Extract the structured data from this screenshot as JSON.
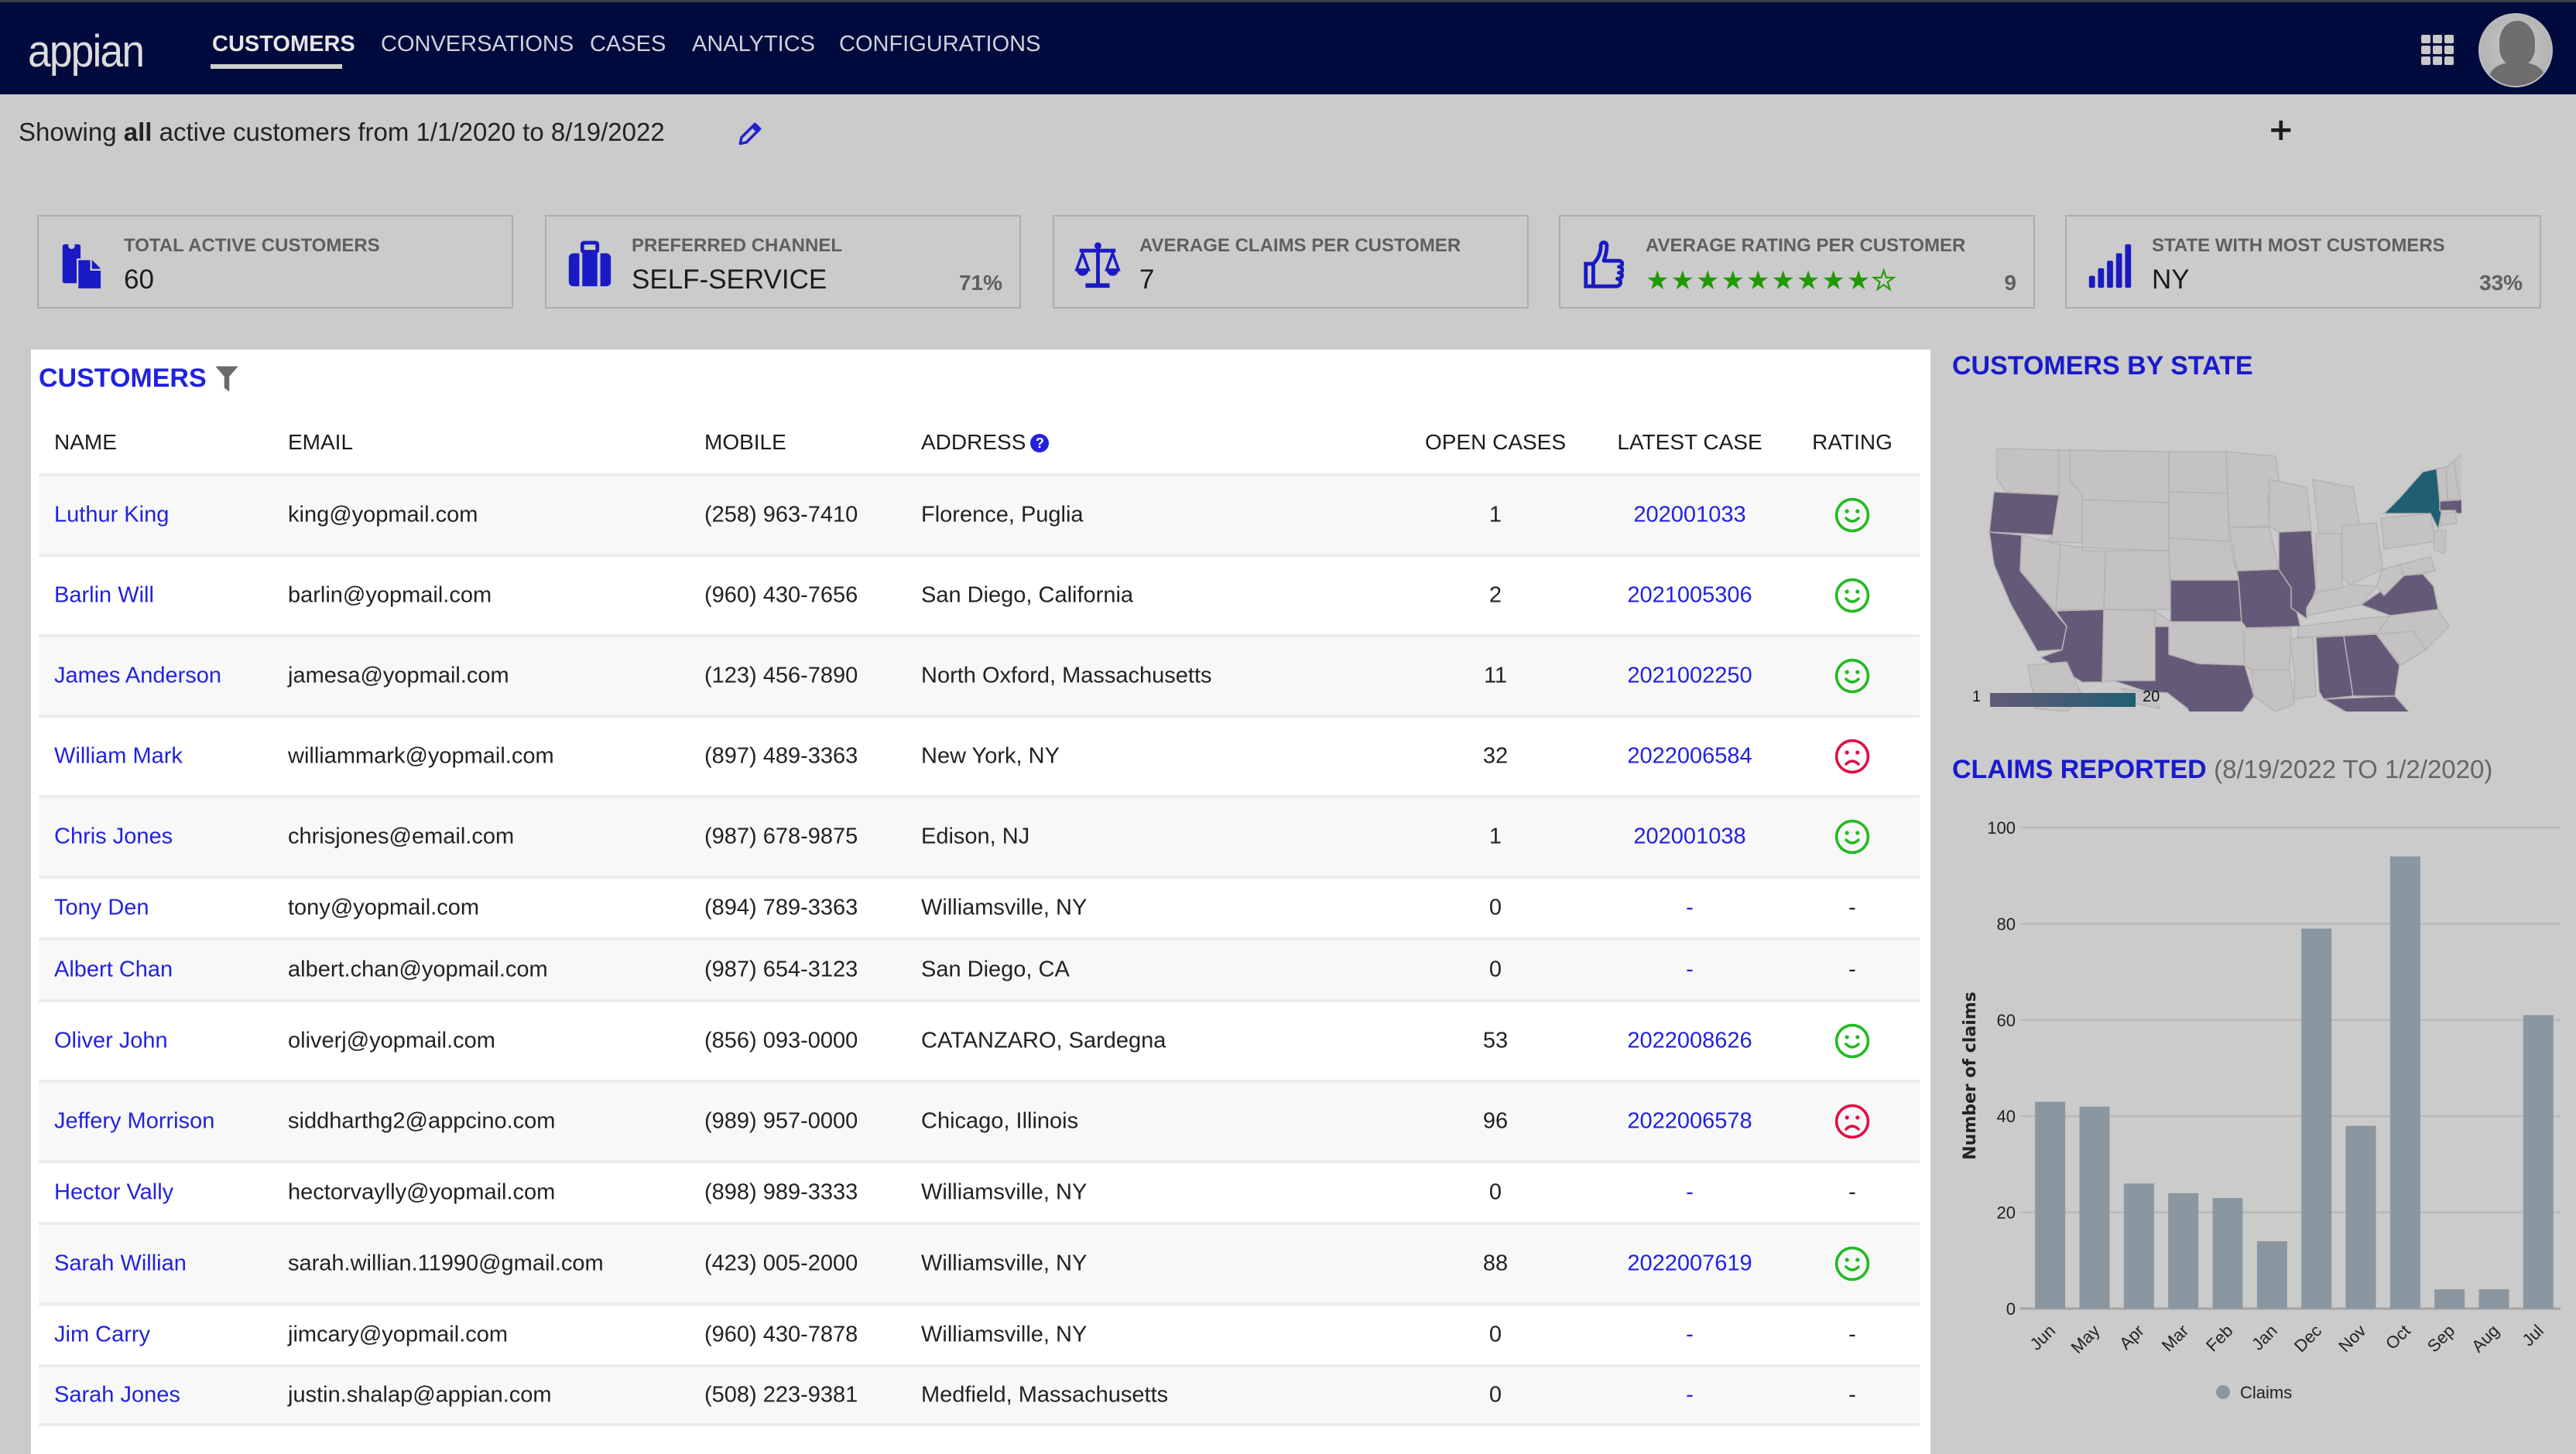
{
  "app": {
    "logo_text": "appian",
    "nav": [
      {
        "label": "CUSTOMERS",
        "active": true
      },
      {
        "label": "CONVERSATIONS",
        "active": false
      },
      {
        "label": "CASES",
        "active": false
      },
      {
        "label": "ANALYTICS",
        "active": false
      },
      {
        "label": "CONFIGURATIONS",
        "active": false
      }
    ],
    "icons": {
      "apps": "grid-icon",
      "user": "avatar-icon"
    }
  },
  "subtitle": {
    "prefix": "Showing ",
    "bold": "all",
    "suffix": " active customers from 1/1/2020 to 8/19/2022"
  },
  "kpis": [
    {
      "label": "TOTAL ACTIVE CUSTOMERS",
      "value": "60",
      "pct": "",
      "icon": "clipboard-icon"
    },
    {
      "label": "PREFERRED CHANNEL",
      "value": "SELF-SERVICE",
      "pct": "71%",
      "icon": "briefcase-icon"
    },
    {
      "label": "AVERAGE CLAIMS PER CUSTOMER",
      "value": "7",
      "pct": "",
      "icon": "scale-icon"
    },
    {
      "label": "AVERAGE RATING PER CUSTOMER",
      "value": "",
      "pct": "9",
      "icon": "thumbs-up-icon",
      "stars_filled": 9,
      "stars_total": 10
    },
    {
      "label": "STATE WITH MOST CUSTOMERS",
      "value": "NY",
      "pct": "33%",
      "icon": "signal-bars-icon"
    }
  ],
  "customers": {
    "title": "CUSTOMERS",
    "columns": [
      "NAME",
      "EMAIL",
      "MOBILE",
      "ADDRESS",
      "OPEN CASES",
      "LATEST CASE",
      "RATING"
    ],
    "rows": [
      {
        "name": "Luthur King",
        "email": "king@yopmail.com",
        "mobile": "(258) 963-7410",
        "address": "Florence, Puglia",
        "open": "1",
        "latest": "202001033",
        "rating": "happy"
      },
      {
        "name": "Barlin Will",
        "email": "barlin@yopmail.com",
        "mobile": "(960) 430-7656",
        "address": "San Diego, California",
        "open": "2",
        "latest": "2021005306",
        "rating": "happy"
      },
      {
        "name": "James Anderson",
        "email": "jamesa@yopmail.com",
        "mobile": "(123) 456-7890",
        "address": "North Oxford, Massachusetts",
        "open": "11",
        "latest": "2021002250",
        "rating": "happy"
      },
      {
        "name": "William Mark",
        "email": "williammark@yopmail.com",
        "mobile": "(897) 489-3363",
        "address": "New York, NY",
        "open": "32",
        "latest": "2022006584",
        "rating": "sad"
      },
      {
        "name": "Chris Jones",
        "email": "chrisjones@email.com",
        "mobile": "(987) 678-9875",
        "address": "Edison, NJ",
        "open": "1",
        "latest": "202001038",
        "rating": "happy"
      },
      {
        "name": "Tony Den",
        "email": "tony@yopmail.com",
        "mobile": "(894) 789-3363",
        "address": "Williamsville, NY",
        "open": "0",
        "latest": "-",
        "rating": "-"
      },
      {
        "name": "Albert Chan",
        "email": "albert.chan@yopmail.com",
        "mobile": "(987) 654-3123",
        "address": "San Diego, CA",
        "open": "0",
        "latest": "-",
        "rating": "-"
      },
      {
        "name": "Oliver John",
        "email": "oliverj@yopmail.com",
        "mobile": "(856) 093-0000",
        "address": "CATANZARO, Sardegna",
        "open": "53",
        "latest": "2022008626",
        "rating": "happy"
      },
      {
        "name": "Jeffery Morrison",
        "email": "siddharthg2@appcino.com",
        "mobile": "(989) 957-0000",
        "address": "Chicago, Illinois",
        "open": "96",
        "latest": "2022006578",
        "rating": "sad"
      },
      {
        "name": "Hector Vally",
        "email": "hectorvaylly@yopmail.com",
        "mobile": "(898) 989-3333",
        "address": "Williamsville, NY",
        "open": "0",
        "latest": "-",
        "rating": "-"
      },
      {
        "name": "Sarah Willian",
        "email": "sarah.willian.11990@gmail.com",
        "mobile": "(423) 005-2000",
        "address": "Williamsville, NY",
        "open": "88",
        "latest": "2022007619",
        "rating": "happy"
      },
      {
        "name": "Jim Carry",
        "email": "jimcary@yopmail.com",
        "mobile": "(960) 430-7878",
        "address": "Williamsville, NY",
        "open": "0",
        "latest": "-",
        "rating": "-"
      },
      {
        "name": "Sarah Jones",
        "email": "justin.shalap@appian.com",
        "mobile": "(508) 223-9381",
        "address": "Medfield, Massachusetts",
        "open": "0",
        "latest": "-",
        "rating": "-"
      }
    ]
  },
  "map": {
    "title": "CUSTOMERS BY STATE",
    "legend_min": "1",
    "legend_max": "20",
    "highlighted_states": [
      "OR",
      "CA",
      "AZ",
      "TX",
      "KS",
      "MO",
      "IL",
      "AL",
      "GA",
      "FL",
      "VA",
      "MA"
    ],
    "top_state": "NY",
    "colors": {
      "low": "#645a78",
      "high": "#205e72",
      "empty": "#c4c2c2"
    }
  },
  "claims": {
    "title": "CLAIMS REPORTED",
    "subtitle": "(8/19/2022 TO 1/2/2020)"
  },
  "chart_data": {
    "type": "bar",
    "title": "CLAIMS REPORTED (8/19/2022 TO 1/2/2020)",
    "categories": [
      "Jun",
      "May",
      "Apr",
      "Mar",
      "Feb",
      "Jan",
      "Dec",
      "Nov",
      "Oct",
      "Sep",
      "Aug",
      "Jul"
    ],
    "series": [
      {
        "name": "Claims",
        "values": [
          43,
          42,
          26,
          24,
          23,
          14,
          79,
          38,
          94,
          4,
          4,
          61
        ],
        "color": "#8a97a0"
      }
    ],
    "xlabel": "",
    "ylabel": "Number of claims",
    "ylim": [
      0,
      100
    ],
    "yticks": [
      0,
      20,
      40,
      60,
      80,
      100
    ],
    "grid": true,
    "legend": "bottom"
  },
  "colors": {
    "nav_bg": "#000a3d",
    "accent": "#2222dd",
    "happy": "#22bb22",
    "sad": "#dd1144",
    "star": "#1f9a00"
  }
}
